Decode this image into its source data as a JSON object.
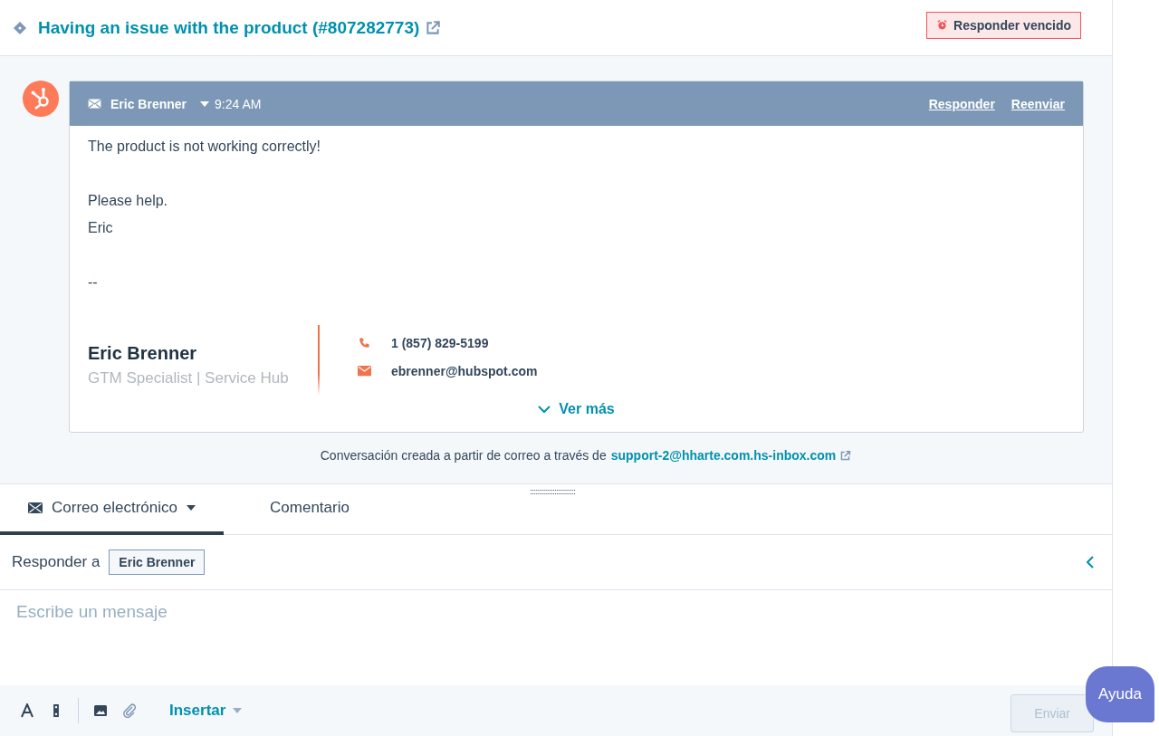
{
  "ticket": {
    "title": "Having an issue with the product (#807282773)",
    "badge": "Responder vencido"
  },
  "message": {
    "sender": "Eric Brenner",
    "time": "9:24 AM",
    "actions": [
      "Responder",
      "Reenviar"
    ],
    "paragraphs": [
      [
        "The product is not working correctly!"
      ],
      [
        "Please help.",
        "Eric"
      ],
      [
        "--"
      ]
    ],
    "signature": {
      "name": "Eric Brenner",
      "title": "GTM Specialist | Service Hub",
      "contacts": [
        {
          "kind": "phone",
          "text": "1 (857) 829-5199"
        },
        {
          "kind": "email",
          "text": "ebrenner@hubspot.com"
        }
      ]
    },
    "more": "Ver más"
  },
  "source_note": {
    "text": "Conversación creada a partir de correo a través de",
    "link": "support-2@hharte.com.hs-inbox.com"
  },
  "composer": {
    "tabs": [
      {
        "label": "Correo electrónico",
        "kind": "email",
        "selected": true
      },
      {
        "label": "Comentario",
        "kind": "comment",
        "selected": false
      }
    ],
    "reply_to_label": "Responder a",
    "recipient": "Eric Brenner",
    "placeholder": "Escribe un mensaje",
    "insert": "Insertar",
    "send": {
      "label": "Enviar",
      "disabled": true
    }
  },
  "help": "Ayuda"
}
